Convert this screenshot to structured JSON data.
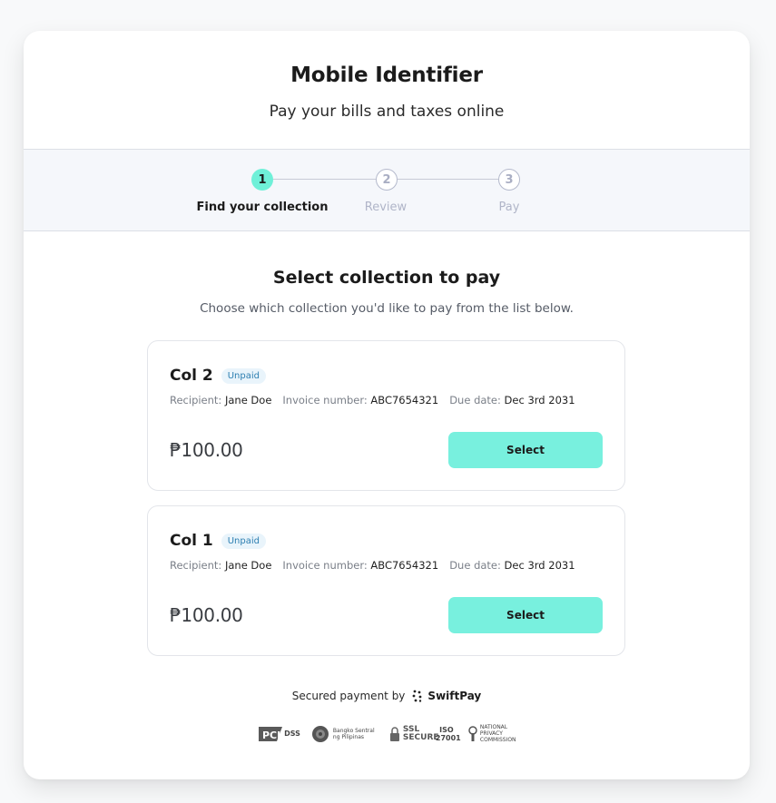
{
  "header": {
    "title": "Mobile Identifier",
    "subtitle": "Pay your bills and taxes online"
  },
  "stepper": {
    "steps": [
      {
        "number": "1",
        "label": "Find your collection",
        "active": true
      },
      {
        "number": "2",
        "label": "Review",
        "active": false
      },
      {
        "number": "3",
        "label": "Pay",
        "active": false
      }
    ]
  },
  "main": {
    "heading": "Select collection to pay",
    "description": "Choose which collection you'd like to pay from the list below.",
    "collections": [
      {
        "name": "Col 2",
        "status": "Unpaid",
        "recipient_label": "Recipient:",
        "recipient": "Jane Doe",
        "invoice_label": "Invoice number:",
        "invoice": "ABC7654321",
        "due_label": "Due date:",
        "due": "Dec 3rd 2031",
        "amount": "₱100.00",
        "button_label": "Select"
      },
      {
        "name": "Col 1",
        "status": "Unpaid",
        "recipient_label": "Recipient:",
        "recipient": "Jane Doe",
        "invoice_label": "Invoice number:",
        "invoice": "ABC7654321",
        "due_label": "Due date:",
        "due": "Dec 3rd 2031",
        "amount": "₱100.00",
        "button_label": "Select"
      }
    ]
  },
  "footer": {
    "secured_text": "Secured payment by",
    "brand": "SwiftPay",
    "certifications": [
      {
        "icon": "pci-dss-logo",
        "text": "DSS"
      },
      {
        "icon": "bangko-sentral-logo",
        "text": "Bangko Sentral ng Pilipinas"
      },
      {
        "icon": "ssl-secure-logo",
        "text": "SSL SECURE"
      },
      {
        "icon": "iso-27001-logo",
        "text": "ISO 27001"
      },
      {
        "icon": "national-privacy-commission-logo",
        "text": "NATIONAL PRIVACY COMMISSION"
      }
    ]
  },
  "colors": {
    "accent": "#78f0de",
    "badge_bg": "#e9f4fb",
    "badge_text": "#2d7fb1",
    "stepper_bg": "#f5f7fb"
  }
}
